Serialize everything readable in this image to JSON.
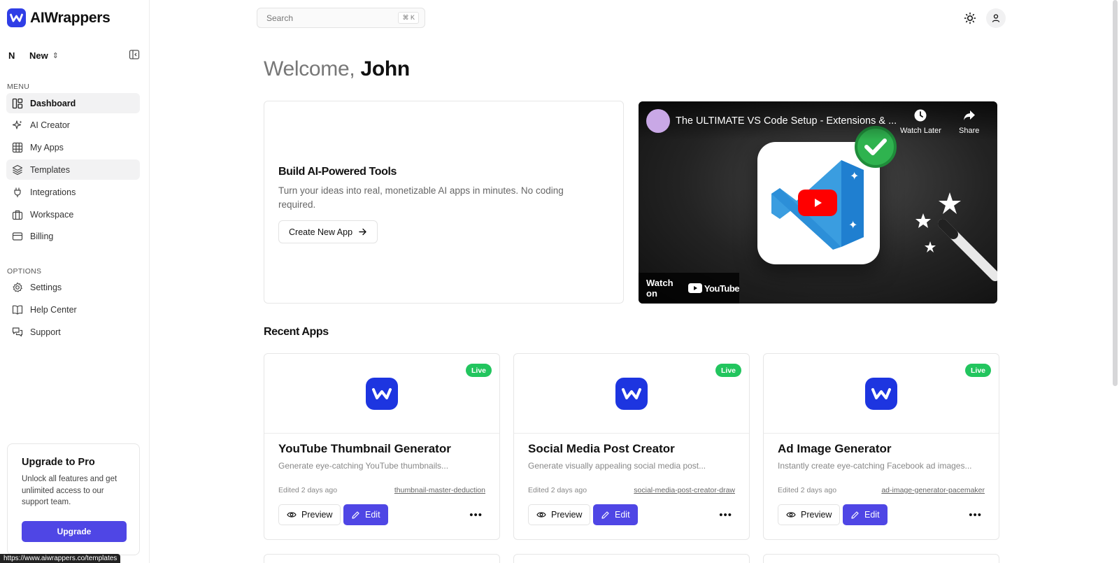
{
  "brand": {
    "name": "AIWrappers"
  },
  "workspace": {
    "initial": "N",
    "name": "New"
  },
  "sidebar": {
    "menu_label": "MENU",
    "menu_items": [
      {
        "label": "Dashboard",
        "icon": "dashboard-icon"
      },
      {
        "label": "AI Creator",
        "icon": "sparkle-icon"
      },
      {
        "label": "My Apps",
        "icon": "grid-icon"
      },
      {
        "label": "Templates",
        "icon": "layers-icon"
      },
      {
        "label": "Integrations",
        "icon": "plug-icon"
      },
      {
        "label": "Workspace",
        "icon": "briefcase-icon"
      },
      {
        "label": "Billing",
        "icon": "credit-card-icon"
      }
    ],
    "options_label": "OPTIONS",
    "option_items": [
      {
        "label": "Settings",
        "icon": "gear-icon"
      },
      {
        "label": "Help Center",
        "icon": "book-icon"
      },
      {
        "label": "Support",
        "icon": "chat-icon"
      }
    ],
    "upgrade": {
      "title": "Upgrade to Pro",
      "text": "Unlock all features and get unlimited access to our support team.",
      "button": "Upgrade"
    }
  },
  "header": {
    "search_placeholder": "Search",
    "search_shortcut": "⌘ K"
  },
  "welcome": {
    "greeting": "Welcome,",
    "name": "John"
  },
  "hero": {
    "title": "Build AI-Powered Tools",
    "description": "Turn your ideas into real, monetizable AI apps in minutes. No coding required.",
    "button": "Create New App"
  },
  "video": {
    "title": "The ULTIMATE VS Code Setup - Extensions & ...",
    "watch_later": "Watch Later",
    "share": "Share",
    "watch_on": "Watch on",
    "youtube": "YouTube"
  },
  "recent": {
    "title": "Recent Apps",
    "apps": [
      {
        "name": "YouTube Thumbnail Generator",
        "description": "Generate eye-catching YouTube thumbnails...",
        "edited": "Edited 2 days ago",
        "slug": "thumbnail-master-deduction",
        "status": "Live",
        "preview": "Preview",
        "edit": "Edit"
      },
      {
        "name": "Social Media Post Creator",
        "description": "Generate visually appealing social media post...",
        "edited": "Edited 2 days ago",
        "slug": "social-media-post-creator-draw",
        "status": "Live",
        "preview": "Preview",
        "edit": "Edit"
      },
      {
        "name": "Ad Image Generator",
        "description": "Instantly create eye-catching Facebook ad images...",
        "edited": "Edited 2 days ago",
        "slug": "ad-image-generator-pacemaker",
        "status": "Live",
        "preview": "Preview",
        "edit": "Edit"
      }
    ]
  },
  "status_bar": {
    "url": "https://www.aiwrappers.co/templates"
  },
  "colors": {
    "brand": "#2f3ee6",
    "accent": "#4f46e5",
    "live": "#22c55e"
  }
}
